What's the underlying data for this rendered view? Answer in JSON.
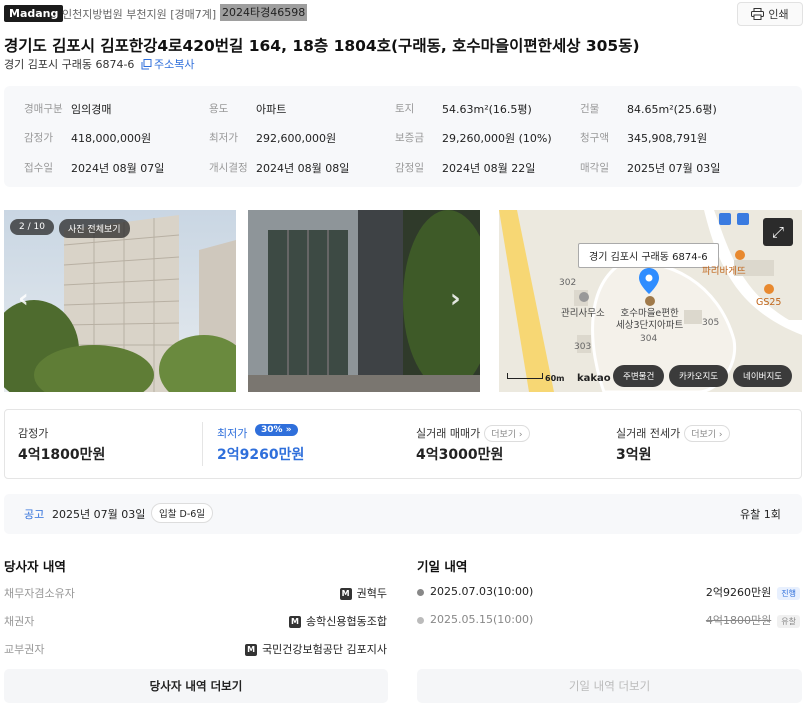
{
  "header": {
    "logo": "Madang",
    "court": "인천지방법원 부천지원 [경매7계]",
    "case_no": "2024타경46598",
    "print_label": "인쇄"
  },
  "title": "경기도 김포시 김포한강4로420번길 164, 18층 1804호(구래동, 호수마을이편한세상 305동)",
  "lot_address": "경기 김포시 구래동 6874-6",
  "copy_label": "주소복사",
  "info": [
    {
      "label": "경매구분",
      "value": "임의경매"
    },
    {
      "label": "용도",
      "value": "아파트"
    },
    {
      "label": "토지",
      "value": "54.63m²(16.5평)"
    },
    {
      "label": "건물",
      "value": "84.65m²(25.6평)"
    },
    {
      "label": "감정가",
      "value": "418,000,000원"
    },
    {
      "label": "최저가",
      "value": "292,600,000원"
    },
    {
      "label": "보증금",
      "value": "29,260,000원 (10%)"
    },
    {
      "label": "청구액",
      "value": "345,908,791원"
    },
    {
      "label": "접수일",
      "value": "2024년 08월 07일"
    },
    {
      "label": "개시결정",
      "value": "2024년 08월 08일"
    },
    {
      "label": "감정일",
      "value": "2024년 08월 22일"
    },
    {
      "label": "매각일",
      "value": "2025년 07월 03일"
    }
  ],
  "photos": {
    "counter": "2 / 10",
    "view_all": "사진 전체보기"
  },
  "map": {
    "pin_label": "경기 김포시 구래동 6874-6",
    "poi_apartment": "호수마을e편한\n세상3단지아파트",
    "poi_office": "관리사무소",
    "poi_bakery": "파리바게뜨",
    "poi_gs": "GS25",
    "bld_302": "302",
    "bld_303": "303",
    "bld_304": "304",
    "bld_305": "305",
    "scale": "60m",
    "provider": "kakao",
    "buttons": [
      "주변물건",
      "카카오지도",
      "네이버지도"
    ]
  },
  "prices": {
    "appraisal_label": "감정가",
    "appraisal_value": "4억1800만원",
    "minimum_label": "최저가",
    "minimum_badge": "30%",
    "minimum_value": "2억9260만원",
    "trade_label": "실거래 매매가",
    "trade_value": "4억3000만원",
    "lease_label": "실거래 전세가",
    "lease_value": "3억원",
    "more_label": "더보기"
  },
  "notice": {
    "tag": "공고",
    "date": "2025년 07월 03일",
    "dday": "입찰 D-6일",
    "fail_count": "유찰 1회"
  },
  "parties": {
    "title": "당사자 내역",
    "rows": [
      {
        "label": "채무자겸소유자",
        "value": "권혁두"
      },
      {
        "label": "채권자",
        "value": "송학신용협동조합"
      },
      {
        "label": "교부권자",
        "value": "국민건강보험공단 김포지사"
      }
    ],
    "more_button": "당사자 내역 더보기"
  },
  "dates": {
    "title": "기일 내역",
    "rows": [
      {
        "date": "2025.07.03(10:00)",
        "price": "2억9260만원",
        "status": "진행"
      },
      {
        "date": "2025.05.15(10:00)",
        "price": "4억1800만원",
        "status": "유찰"
      }
    ],
    "more_button": "기일 내역 더보기"
  },
  "colors": {
    "accent": "#2f6fdb",
    "status_progress_bg": "#e8f0fe",
    "status_fail_bg": "#f0f0f0"
  }
}
